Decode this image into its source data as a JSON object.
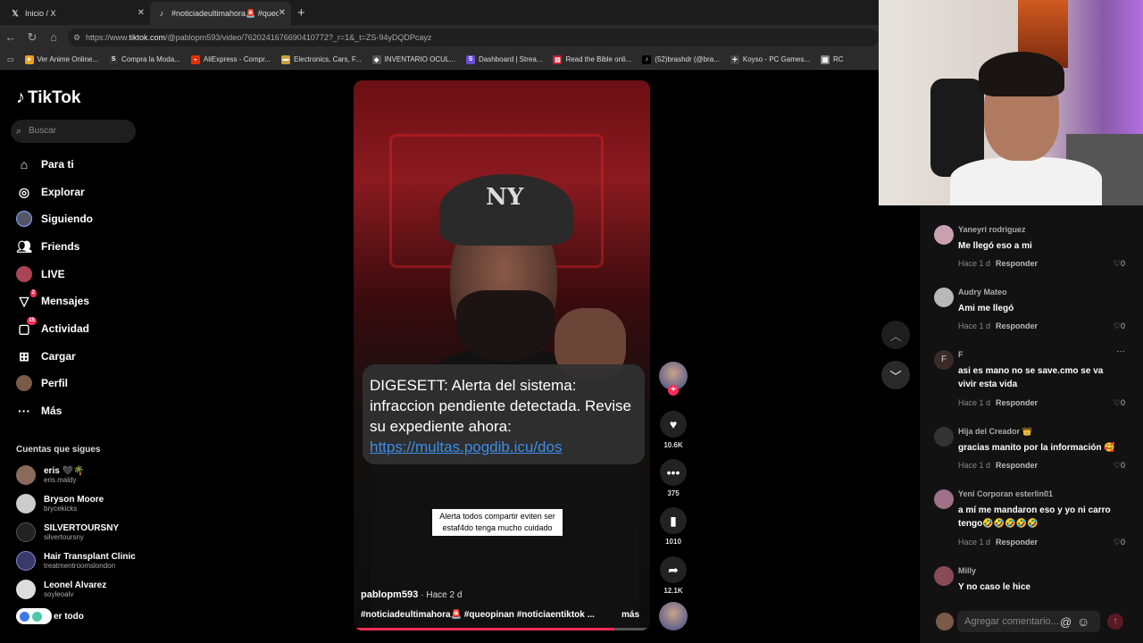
{
  "browser": {
    "tabs": [
      {
        "label": "Inicio / X"
      },
      {
        "label": "#noticiadeultimahora🚨 #queopi"
      }
    ],
    "url_prefix": "https://www.",
    "url_domain": "tiktok.com",
    "url_rest": "/@pablopm593/video/7620241676690410772?_r=1&_t=ZS-94yDQDPcayz",
    "bookmarks": [
      "Ver Anime Online...",
      "Compra la Moda...",
      "AliExpress - Compr...",
      "Electronics, Cars, F...",
      "INVENTARIO OCUL...",
      "Dashboard | Strea...",
      "Read the Bible onli...",
      "(52)brashdr (@bra...",
      "Koyso - PC Games...",
      "RC"
    ]
  },
  "sidebar": {
    "logo": "TikTok",
    "search_placeholder": "Buscar",
    "nav": [
      {
        "label": "Para ti",
        "icon": "home-icon"
      },
      {
        "label": "Explorar",
        "icon": "compass-icon"
      },
      {
        "label": "Siguiendo",
        "icon": "following-icon"
      },
      {
        "label": "Friends",
        "icon": "friends-icon"
      },
      {
        "label": "LIVE",
        "icon": "live-icon"
      },
      {
        "label": "Mensajes",
        "icon": "messages-icon",
        "badge": "2"
      },
      {
        "label": "Actividad",
        "icon": "activity-icon",
        "badge": "15"
      },
      {
        "label": "Cargar",
        "icon": "upload-icon"
      },
      {
        "label": "Perfil",
        "icon": "profile-icon"
      },
      {
        "label": "Más",
        "icon": "more-icon"
      }
    ],
    "following_title": "Cuentas que sigues",
    "accounts": [
      {
        "name": "eris 🖤🌴",
        "handle": "eris.maldy"
      },
      {
        "name": "Bryson Moore",
        "handle": "brycekicks"
      },
      {
        "name": "SILVERTOURSNY",
        "handle": "silvertoursny"
      },
      {
        "name": "Hair Transplant Clinic",
        "handle": "treatmentroomslondon"
      },
      {
        "name": "Leonel Alvarez",
        "handle": "soyleoalv"
      }
    ],
    "see_all": "er todo"
  },
  "video": {
    "sms_text": "DIGESETT: Alerta del sistema: infraccion pendiente detectada. Revise su expediente ahora: ",
    "sms_link": "https://multas.pogdib.icu/dos",
    "subtitle": "Alerta todos compartir eviten ser estaf4do tenga mucho cuidado",
    "author": "pablopm593",
    "ago": "· Hace 2 d",
    "tags": "#noticiadeultimahora🚨 #queopinan #noticiaentiktok ...",
    "more": "más",
    "progress": 0.88
  },
  "actions": {
    "likes": "10.6K",
    "comments": "375",
    "saves": "1010",
    "shares": "12.1K"
  },
  "comments": [
    {
      "user": "Yaneyri rodriguez",
      "text": "Me llegó eso a mi",
      "time": "Hace 1 d",
      "reply": "Responder",
      "likes": "0"
    },
    {
      "user": "Audry Mateo",
      "text": "Ami me llegó",
      "time": "Hace 1 d",
      "reply": "Responder",
      "likes": "0"
    },
    {
      "user": "F",
      "text": "asi es mano no se save.cmo se va vivir esta vida",
      "time": "Hace 1 d",
      "reply": "Responder",
      "likes": "0"
    },
    {
      "user": "Hija del Creador 👑",
      "text": "gracias manito por la información 🥰",
      "time": "Hace 1 d",
      "reply": "Responder",
      "likes": "0"
    },
    {
      "user": "Yeni Corporan esterlin01",
      "text": "a mí me mandaron eso y yo ni carro tengo🤣🤣🤣🤣🤣",
      "time": "Hace 1 d",
      "reply": "Responder",
      "likes": "0"
    },
    {
      "user": "Milly",
      "text": "Y no caso le hice"
    }
  ],
  "comment_input": {
    "placeholder": "Agregar comentario..."
  },
  "colors": {
    "accent": "#fe2c55",
    "link": "#3b8ee8",
    "background": "#000000",
    "panel": "#121212"
  }
}
